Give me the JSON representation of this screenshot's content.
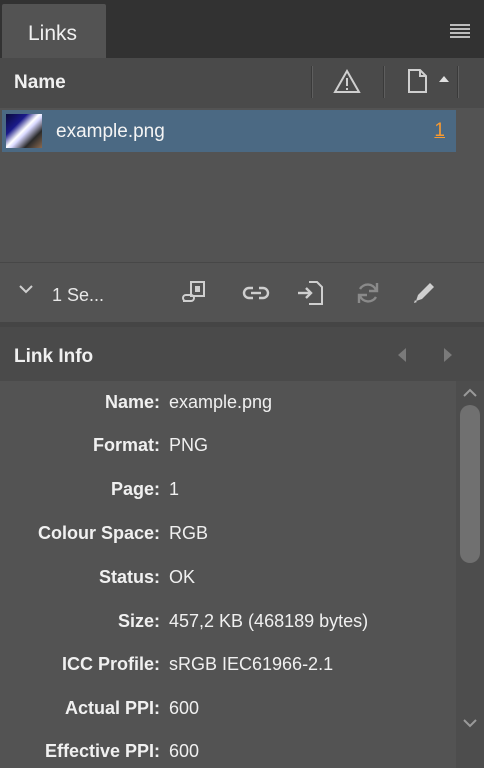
{
  "panel": {
    "tab_label": "Links",
    "menu_icon": "hamburger-menu-icon"
  },
  "header": {
    "name_label": "Name",
    "status_icon": "warning-icon",
    "page_icon": "page-icon"
  },
  "links": [
    {
      "filename": "example.png",
      "page": "1",
      "thumbnail": "image-thumbnail"
    }
  ],
  "toolbar": {
    "selection_text": "1 Se...",
    "icons": [
      "relink-to-folder-icon",
      "relink-icon",
      "go-to-link-icon",
      "update-link-icon",
      "edit-original-icon"
    ]
  },
  "link_info": {
    "title": "Link Info",
    "fields": [
      {
        "label": "Name:",
        "value": "example.png"
      },
      {
        "label": "Format:",
        "value": "PNG"
      },
      {
        "label": "Page:",
        "value": "1"
      },
      {
        "label": "Colour Space:",
        "value": "RGB"
      },
      {
        "label": "Status:",
        "value": "OK"
      },
      {
        "label": "Size:",
        "value": "457,2 KB (468189 bytes)"
      },
      {
        "label": "ICC Profile:",
        "value": "sRGB IEC61966-2.1"
      },
      {
        "label": "Actual PPI:",
        "value": "600"
      },
      {
        "label": "Effective PPI:",
        "value": "600"
      }
    ]
  },
  "colors": {
    "selection": "#4b6983",
    "page_link": "#f79a31",
    "panel_bg": "#535353"
  }
}
